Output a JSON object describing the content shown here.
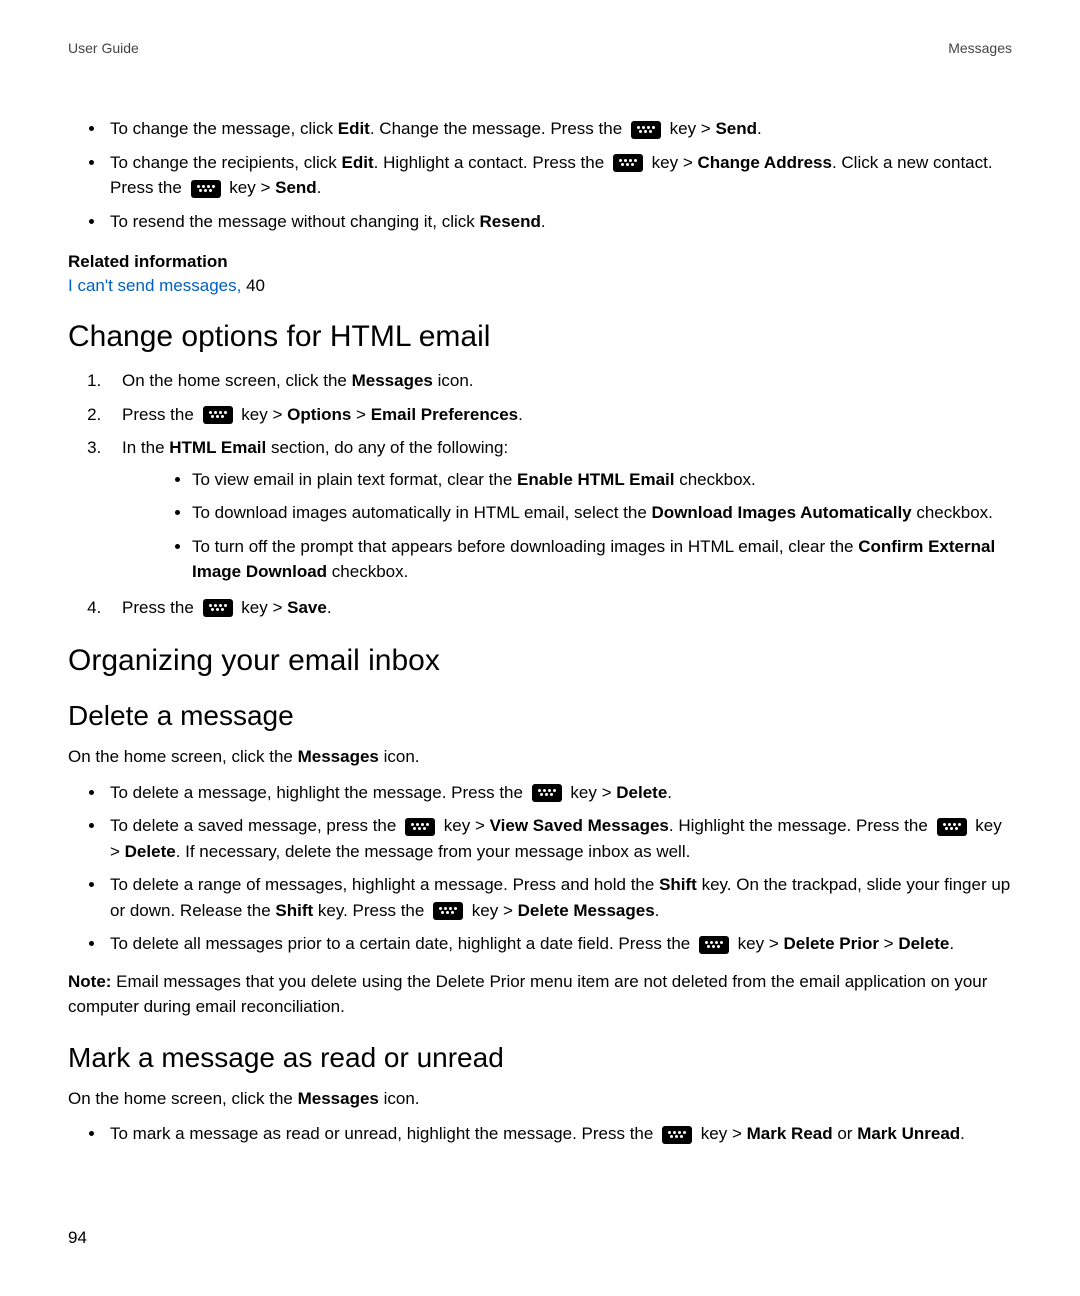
{
  "header": {
    "left": "User Guide",
    "right": "Messages"
  },
  "topBullets": {
    "b1a": "To change the message, click ",
    "b1b": ". Change the message. Press the ",
    "b1c": " key > ",
    "edit": "Edit",
    "send": "Send",
    "period": ".",
    "b2a": "To change the recipients, click ",
    "b2b": ". Highlight a contact. Press the ",
    "b2c": " key > ",
    "changeAddress": "Change Address",
    "b2d": ". Click a new contact. Press the ",
    "b2e": " key > ",
    "b3a": "To resend the message without changing it, click ",
    "resend": "Resend"
  },
  "related": {
    "title": "Related information",
    "linkText": "I can't send messages,",
    "page": " 40"
  },
  "htmlEmail": {
    "heading": "Change options for HTML email",
    "s1a": "On the home screen, click the ",
    "messages": "Messages",
    "s1b": " icon.",
    "s2a": "Press the ",
    "s2b": " key > ",
    "options": "Options",
    "gt": " > ",
    "emailPrefs": "Email Preferences",
    "s3a": "In the ",
    "htmlEmailSection": "HTML Email",
    "s3b": " section, do any of the following:",
    "n1a": "To view email in plain text format, clear the ",
    "enableHtml": "Enable HTML Email",
    "checkbox": " checkbox.",
    "n2a": "To download images automatically in HTML email, select the ",
    "downloadAuto": "Download Images Automatically",
    "n3a": "To turn off the prompt that appears before downloading images in HTML email, clear the ",
    "confirmExt": "Confirm External Image Download",
    "s4a": "Press the ",
    "s4b": " key > ",
    "save": "Save"
  },
  "organizing": {
    "heading": "Organizing your email inbox"
  },
  "deleteMsg": {
    "heading": "Delete a message",
    "open": "On the home screen, click the ",
    "messages": "Messages",
    "openB": " icon.",
    "d1a": "To delete a message, highlight the message. Press the ",
    "keyGt": " key > ",
    "delete": "Delete",
    "period": ".",
    "d2a": "To delete a saved message, press the ",
    "viewSaved": "View Saved Messages",
    "d2b": ". Highlight the message. Press the ",
    "d2c": " key > ",
    "d2d": ". If necessary, delete the message from your message inbox as well.",
    "d3a": "To delete a range of messages, highlight a message. Press and hold the ",
    "shift": "Shift",
    "d3b": " key. On the trackpad, slide your finger up or down. Release the ",
    "d3c": " key. Press the ",
    "deleteMessages": "Delete Messages",
    "d4a": "To delete all messages prior to a certain date, highlight a date field. Press the ",
    "deletePrior": "Delete Prior",
    "gt": " > ",
    "noteLabel": "Note:",
    "noteText": " Email messages that you delete using the Delete Prior menu item are not deleted from the email application on your computer during email reconciliation."
  },
  "markMsg": {
    "heading": "Mark a message as read or unread",
    "open": "On the home screen, click the ",
    "messages": "Messages",
    "openB": " icon.",
    "m1a": "To mark a message as read or unread, highlight the message. Press the ",
    "keyGt": " key > ",
    "markRead": "Mark Read",
    "or": " or ",
    "markUnread": "Mark Unread",
    "period": "."
  },
  "pageNumber": "94"
}
